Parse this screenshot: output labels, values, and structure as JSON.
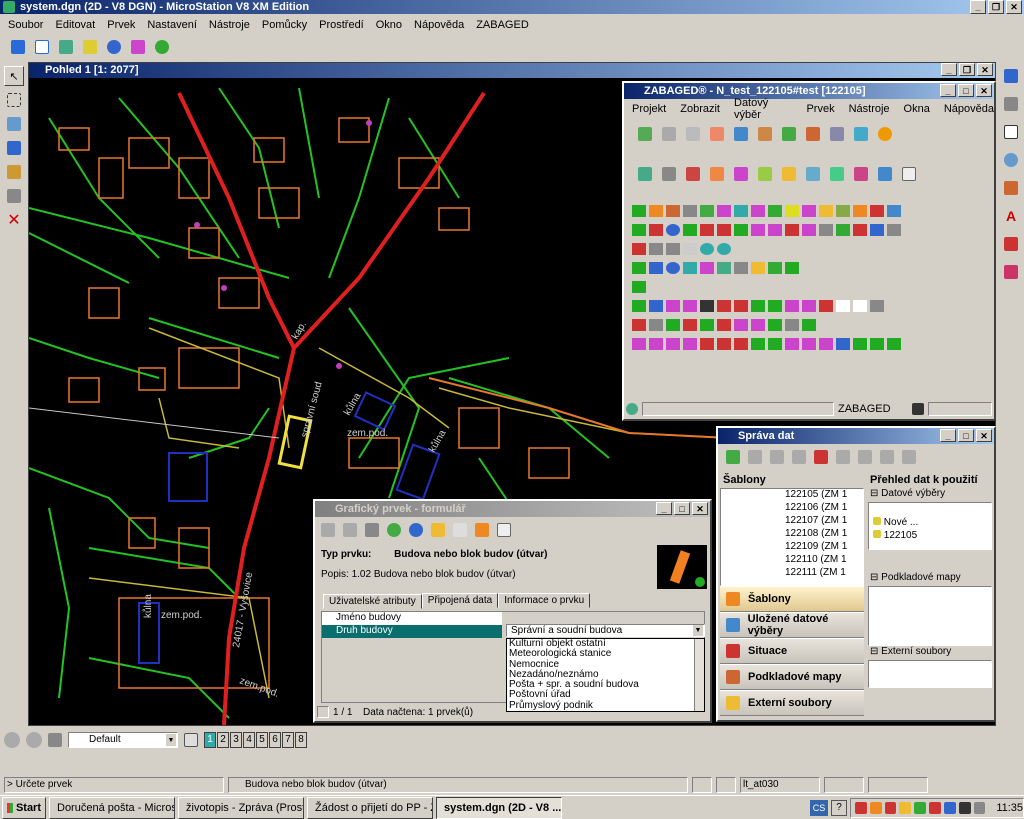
{
  "app": {
    "title": "system.dgn (2D - V8 DGN) - MicroStation V8 XM Edition",
    "menu": [
      "Soubor",
      "Editovat",
      "Prvek",
      "Nastavení",
      "Nástroje",
      "Pomůcky",
      "Prostředí",
      "Okno",
      "Nápověda",
      "ZABAGED"
    ]
  },
  "view": {
    "title": "Pohled 1 [1: 2077]",
    "map_labels": {
      "kap": "kap.",
      "spravni_soud": "správní soud",
      "kulna1": "kůlna",
      "zem_pod1": "zem.pod.",
      "kulna2": "kůlna",
      "kulna3": "kůlna",
      "zem_pod2": "zem.pod.",
      "road": "24017 - Vyšovice",
      "zem_pod3": "zem.pod."
    }
  },
  "zabaged": {
    "title": "ZABAGED® - N_test_122105#test [122105]",
    "menu": [
      "Projekt",
      "Zobrazit",
      "Datový výběr",
      "Prvek",
      "Nástroje",
      "Okna",
      "Nápověda"
    ],
    "status": "ZABAGED"
  },
  "sprava": {
    "title": "Správa dat",
    "left_header": "Šablony",
    "right_header": "Přehled dat k použití",
    "sablony": [
      "122105 (ZM 1",
      "122106 (ZM 1",
      "122107 (ZM 1",
      "122108 (ZM 1",
      "122109 (ZM 1",
      "122110 (ZM 1",
      "122111 (ZM 1"
    ],
    "nav": [
      "Šablony",
      "Uložené datové výběry",
      "Situace",
      "Podkladové mapy",
      "Externí soubory"
    ],
    "sections": {
      "datove_vybery": "Datové výběry",
      "nove": "Nové ...",
      "item_122105": "122105",
      "podkladove": "Podkladové mapy",
      "externi": "Externí soubory"
    }
  },
  "form": {
    "title": "Grafický prvek - formulář",
    "type_label": "Typ prvku:",
    "type_value": "Budova nebo blok budov (útvar)",
    "popis": "Popis: 1.02 Budova nebo blok budov (útvar)",
    "tabs": [
      "Uživatelské atributy",
      "Připojená data",
      "Informace o prvku"
    ],
    "attr_rows": [
      "Jméno budovy",
      "Druh budovy"
    ],
    "selected_value": "Správní a soudní budova",
    "options": [
      "Kulturní objekt ostatní",
      "Meteorologická stanice",
      "Nemocnice",
      "Nezadáno/neznámo",
      "Pošta + spr. a soudní budova",
      "Poštovní úřad",
      "Průmyslový podnik"
    ],
    "page": "1 / 1",
    "status": "Data načtena: 1 prvek(ů)"
  },
  "bottom": {
    "level": "Default",
    "pages": [
      "1",
      "2",
      "3",
      "4",
      "5",
      "6",
      "7",
      "8"
    ],
    "prompt": "> Určete prvek",
    "status_mid": "Budova nebo blok budov (útvar)",
    "status_right": "lt_at030"
  },
  "taskbar": {
    "start": "Start",
    "tasks": [
      "Doručená pošta - Microso...",
      "životopis - Zpráva (Prostý...",
      "Žádost o přijetí do PP - Z...",
      "system.dgn (2D - V8 ..."
    ],
    "tray_cs": "CS",
    "clock": "11:35"
  }
}
